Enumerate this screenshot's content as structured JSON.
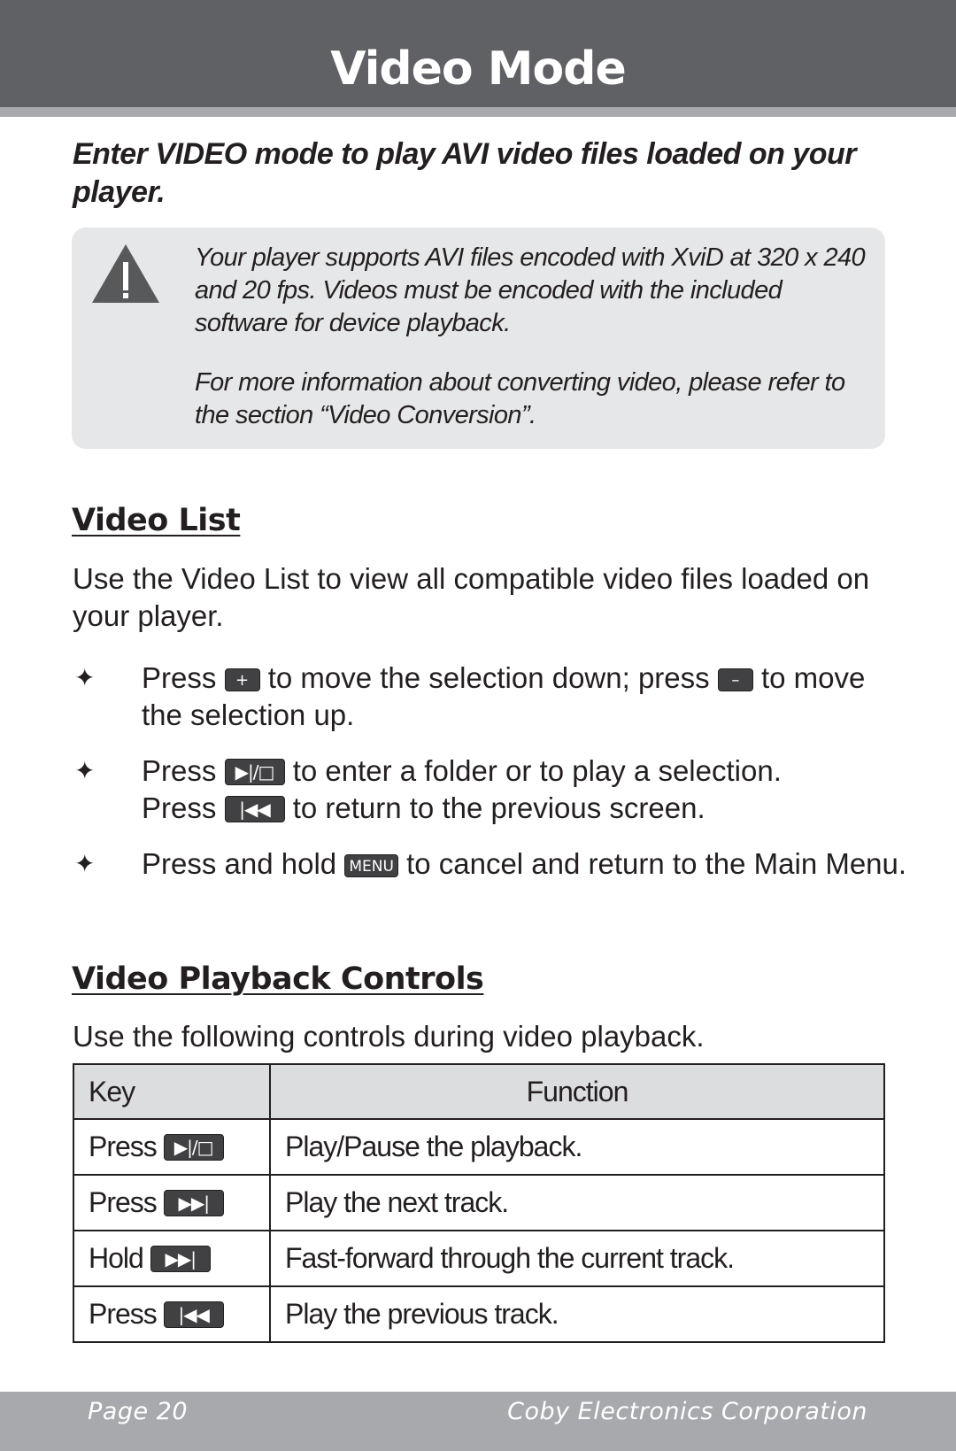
{
  "header": {
    "title": "Video Mode"
  },
  "intro": "Enter VIDEO mode to play AVI video files loaded on your player.",
  "note": {
    "icon": "warning-icon",
    "paragraphs": [
      "Your player supports AVI files encoded with XviD at 320 x 240 and 20 fps. Videos must be encoded with the included software for device playback.",
      "For more information about converting video, please refer to the section “Video Conversion”."
    ]
  },
  "video_list": {
    "heading": "Video List",
    "description": "Use the Video List to view all compatible video files loaded on your player.",
    "bullets": [
      {
        "t1": "Press",
        "k1": "+",
        "t2": "to move the selection down; press",
        "k2": "–",
        "t3": "to move the selection up."
      },
      {
        "t1": "Press",
        "k1": "▶|/□",
        "t2": "to enter a folder or to play a selection.",
        "t3": "Press",
        "k2": "|◀◀",
        "t4": "to return to the previous screen."
      },
      {
        "t1": "Press and hold",
        "k1": "MENU",
        "t2": "to cancel and return to the Main Menu."
      }
    ]
  },
  "playback": {
    "heading": "Video Playback Controls",
    "description": "Use the following controls during video playback.",
    "table": {
      "headers": [
        "Key",
        "Function"
      ],
      "rows": [
        {
          "action": "Press",
          "key": "▶|/□",
          "function": "Play/Pause the playback."
        },
        {
          "action": "Press",
          "key": "▶▶|",
          "function": "Play the next track."
        },
        {
          "action": "Hold",
          "key": "▶▶|",
          "function": "Fast-forward through the current track."
        },
        {
          "action": "Press",
          "key": "|◀◀",
          "function": "Play the previous track."
        }
      ]
    }
  },
  "footer": {
    "page": "Page 20",
    "company": "Coby Electronics Corporation"
  }
}
